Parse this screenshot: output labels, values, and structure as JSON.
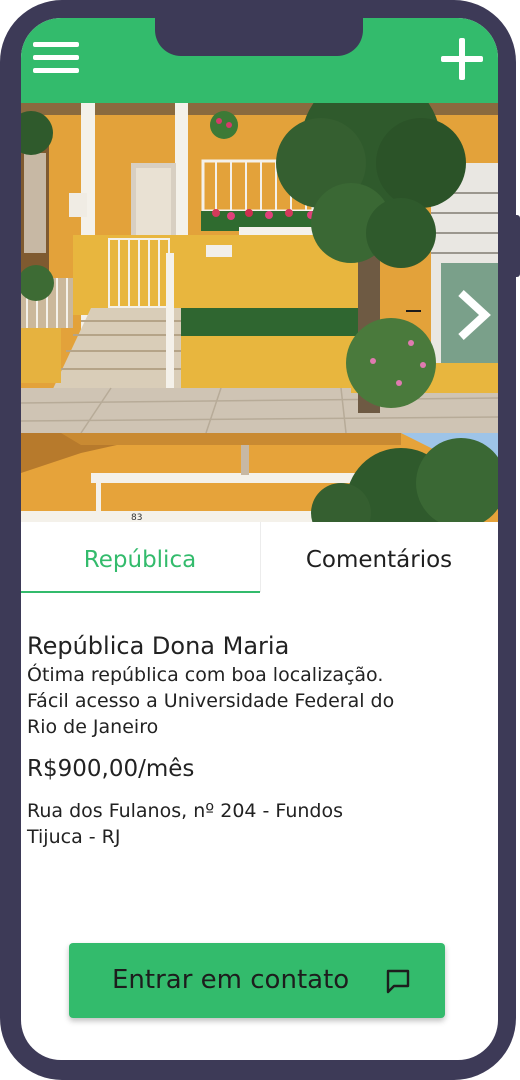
{
  "header": {
    "menu_icon": "hamburger-menu-icon",
    "add_icon": "plus-icon"
  },
  "gallery": {
    "next_icon": "chevron-right-icon",
    "main_house_number": "83",
    "thumb_house_number": "83"
  },
  "tabs": [
    {
      "label": "República",
      "active": true
    },
    {
      "label": "Comentários",
      "active": false
    }
  ],
  "listing": {
    "title": "República Dona Maria",
    "description_line1": "Ótima república com boa localização.",
    "description_line2": "Fácil acesso a Universidade Federal do",
    "description_line3": "Rio de Janeiro",
    "price": "R$900,00/mês",
    "address_line1": "Rua dos Fulanos, nº 204 - Fundos",
    "address_line2": "Tijuca - RJ"
  },
  "contact_button": {
    "label": "Entrar em contato",
    "icon": "message-bubble-icon"
  },
  "colors": {
    "accent": "#33bb6c",
    "frame": "#3d3a57",
    "wall": "#e8a93a"
  }
}
